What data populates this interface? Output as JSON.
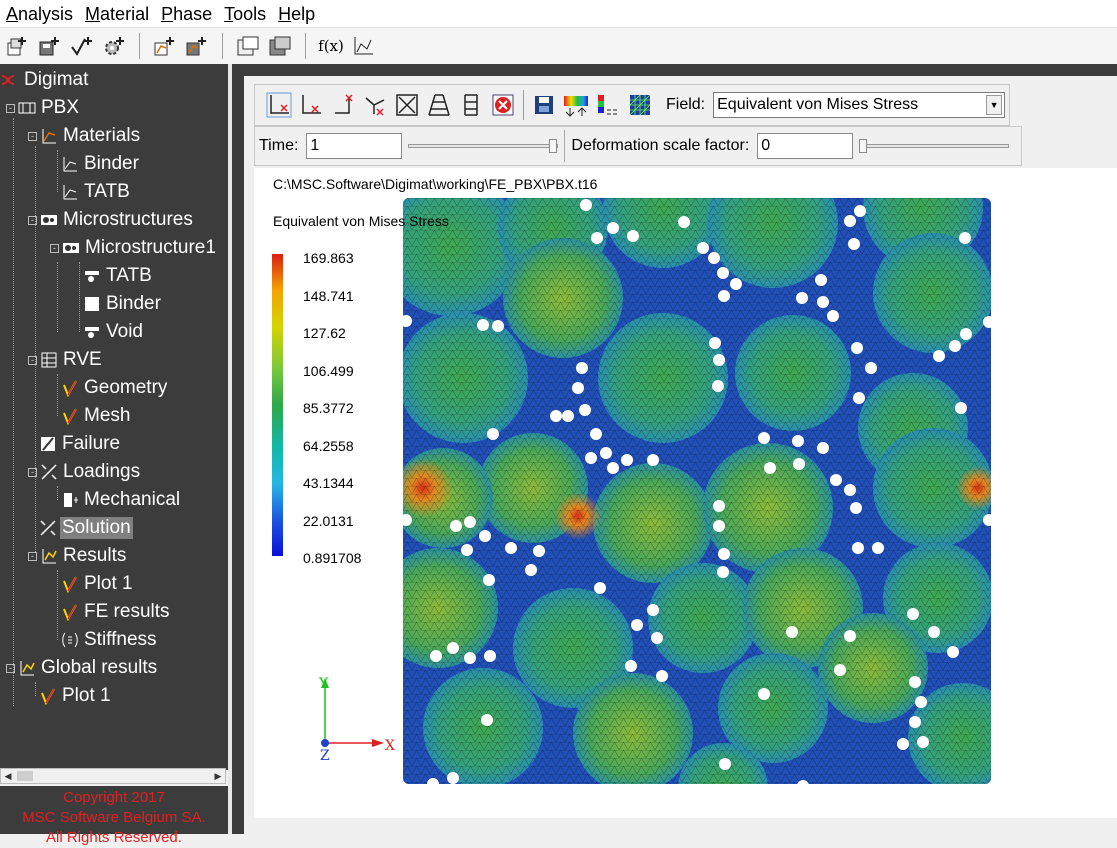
{
  "menu": [
    {
      "mnemonic": "A",
      "rest": "nalysis"
    },
    {
      "mnemonic": "M",
      "rest": "aterial"
    },
    {
      "mnemonic": "P",
      "rest": "hase"
    },
    {
      "mnemonic": "T",
      "rest": "ools"
    },
    {
      "mnemonic": "H",
      "rest": "elp"
    }
  ],
  "toolbar": {
    "fx_label": "f(x)"
  },
  "tree": {
    "root": "Digimat",
    "project": "PBX",
    "materials": "Materials",
    "binder": "Binder",
    "tatb": "TATB",
    "microstructures": "Microstructures",
    "microstructure1": "Microstructure1",
    "phase_tatb": "TATB",
    "phase_binder": "Binder",
    "phase_void": "Void",
    "rve": "RVE",
    "geometry": "Geometry",
    "mesh": "Mesh",
    "failure": "Failure",
    "loadings": "Loadings",
    "mechanical": "Mechanical",
    "solution": "Solution",
    "results": "Results",
    "plot1": "Plot 1",
    "fe_results": "FE results",
    "stiffness": "Stiffness",
    "global_results": "Global results",
    "global_plot1": "Plot 1"
  },
  "copyright": {
    "line1": "Copyright 2017",
    "line2": "MSC Software Belgium SA.",
    "line3": "All Rights Reserved."
  },
  "viewer": {
    "field_label": "Field:",
    "field_value": "Equivalent von Mises Stress",
    "time_label": "Time:",
    "time_value": "1",
    "deform_label": "Deformation scale factor:",
    "deform_value": "0",
    "file_path": "C:\\MSC.Software\\Digimat\\working\\FE_PBX\\PBX.t16",
    "legend_title": "Equivalent von Mises Stress",
    "legend_values": [
      "169.863",
      "148.741",
      "127.62",
      "106.499",
      "85.3772",
      "64.2558",
      "43.1344",
      "22.0131",
      "0.891708"
    ],
    "axis_x": "X",
    "axis_y": "Y",
    "axis_z": "Z"
  },
  "colors": {
    "tree_bg": "#3c3c3c",
    "copyright": "#e02020",
    "stress_high": "#d81e12",
    "stress_low": "#0a10d8"
  }
}
